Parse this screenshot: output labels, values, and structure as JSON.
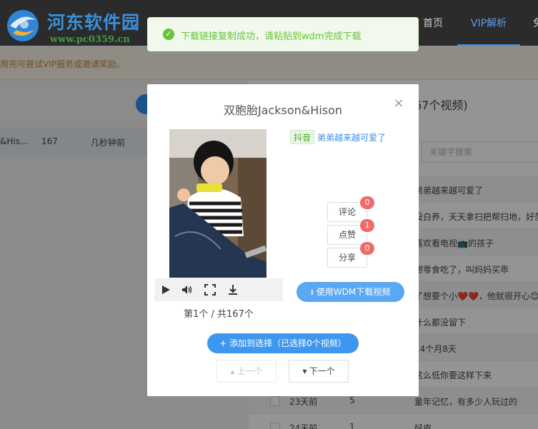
{
  "brand": {
    "title": "河东软件园",
    "url": "www.pc0359.cn"
  },
  "nav": {
    "home": "首页",
    "vip": "VIP解析",
    "more": "免"
  },
  "notice": {
    "text": "用完可尝试VIP服务或邀请奖励。"
  },
  "left_list": {
    "row": {
      "name": "&His...",
      "count": "167",
      "time": "几秒钟前"
    }
  },
  "right_panel": {
    "heading": "67个视频)",
    "search_placeholder": "关键字搜索",
    "rows": [
      {
        "time": "",
        "count": "",
        "desc": "弟弟越来越可爱了"
      },
      {
        "time": "",
        "count": "",
        "desc": "没白养，天天拿扫把帮扫地，好羡"
      },
      {
        "time": "",
        "count": "",
        "desc": "喜欢看电视📺的孩子"
      },
      {
        "time": "",
        "count": "",
        "desc": "想零食吃了，叫妈妈买乖"
      },
      {
        "time": "",
        "count": "",
        "desc": "了想要个小❤️❤️，他就很开心😊"
      },
      {
        "time": "",
        "count": "",
        "desc": "什么都没留下"
      },
      {
        "time": "",
        "count": "",
        "desc": "14个月8天"
      },
      {
        "time": "",
        "count": "",
        "desc": "这么低你要这样下来"
      },
      {
        "time": "23天前",
        "count": "5",
        "desc": "童年记忆，有多少人玩过的"
      },
      {
        "time": "24天前",
        "count": "1",
        "desc": "好皮"
      }
    ]
  },
  "toast": {
    "text": "下载链接复制成功，请粘贴到wdm完成下载"
  },
  "modal": {
    "title": "双胞胎Jackson&Hison",
    "platform_tag": "抖音",
    "video_desc": "弟弟越来越可爱了",
    "comment_label": "评论",
    "comment_count": "0",
    "like_label": "点赞",
    "like_count": "1",
    "share_label": "分享",
    "share_count": "0",
    "wdm_button": "使用WDM下载视频",
    "page_info": "第1个 / 共167个",
    "add_button": "添加到选择（已选择0个视频）",
    "prev_button": "上一个",
    "next_button": "下一个"
  },
  "colors": {
    "accent": "#3e97ee",
    "success": "#67c23a",
    "badge": "#ef6a6a",
    "topbar": "#2b2b2b"
  },
  "icons": [
    "check-circle-icon",
    "close-icon",
    "play-icon",
    "volume-icon",
    "fullscreen-icon",
    "download-icon",
    "plus-icon",
    "caret-up-icon",
    "caret-down-icon"
  ]
}
